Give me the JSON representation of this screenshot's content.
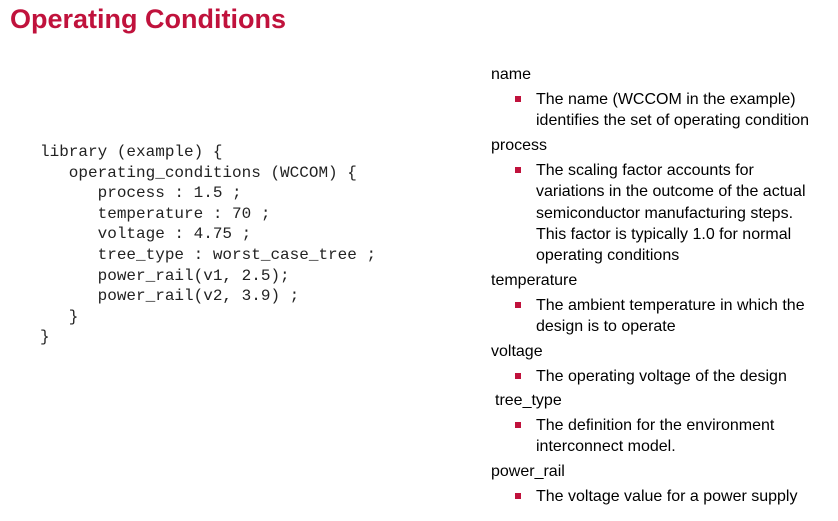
{
  "title": "Operating Conditions",
  "accent_color": "#c0123c",
  "code": {
    "lines": [
      "library (example) {",
      "   operating_conditions (WCCOM) {",
      "      process : 1.5 ;",
      "      temperature : 70 ;",
      "      voltage : 4.75 ;",
      "      tree_type : worst_case_tree ;",
      "      power_rail(v1, 2.5);",
      "      power_rail(v2, 3.9) ;",
      "   }",
      "}"
    ]
  },
  "definitions": [
    {
      "term": "name",
      "lines": [
        "The name (WCCOM in the example)",
        "identifies the set of operating condition"
      ]
    },
    {
      "term": "process",
      "lines": [
        "The scaling factor accounts for",
        "variations in the outcome of the actual",
        "semiconductor manufacturing steps.",
        "This factor is typically 1.0 for normal",
        "operating conditions"
      ]
    },
    {
      "term": "temperature",
      "lines": [
        "The ambient temperature in which the",
        "design is to operate"
      ]
    },
    {
      "term": "voltage",
      "lines": [
        "The operating voltage of the design"
      ]
    },
    {
      "term": "tree_type",
      "lines": [
        "The definition for the environment",
        "interconnect model."
      ]
    },
    {
      "term": "power_rail",
      "lines": [
        "The voltage value for a power supply"
      ]
    }
  ]
}
